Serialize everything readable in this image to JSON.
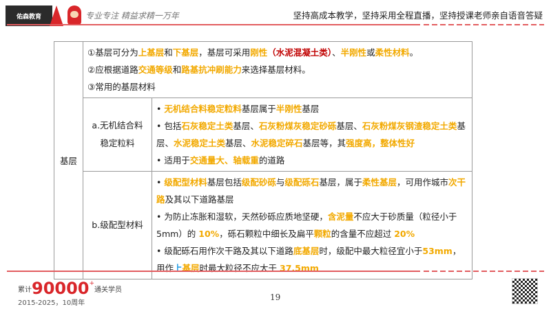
{
  "header": {
    "logo_text": "佑森教育",
    "calligraphy": "专业专注 精益求精一万年",
    "slogan": "坚持高成本教学，坚持采用全程直播，坚持授课老师亲自语音答疑"
  },
  "colors": {
    "orange": "#f2a900",
    "red": "#c00000",
    "blue": "#1e9be6",
    "brand": "#d9262a"
  },
  "table": {
    "row_header": "基层",
    "intro": [
      [
        {
          "t": "①基层可分为"
        },
        {
          "t": "上基层",
          "c": "o"
        },
        {
          "t": "和"
        },
        {
          "t": "下基层",
          "c": "o"
        },
        {
          "t": "，基层可采用"
        },
        {
          "t": "刚性",
          "c": "o"
        },
        {
          "t": "（水泥混凝土类）",
          "c": "r"
        },
        {
          "t": "、"
        },
        {
          "t": "半刚性",
          "c": "o"
        },
        {
          "t": "或"
        },
        {
          "t": "柔性材料",
          "c": "o"
        },
        {
          "t": "。"
        }
      ],
      [
        {
          "t": "②应根据道路"
        },
        {
          "t": "交通等级",
          "c": "o"
        },
        {
          "t": "和"
        },
        {
          "t": "路基抗冲刷能力",
          "c": "o"
        },
        {
          "t": "来选择基层材料。"
        }
      ],
      [
        {
          "t": "③常用的基层材料"
        }
      ]
    ],
    "rows": [
      {
        "label_1": "a.无机结合料",
        "label_2": "稳定粒料",
        "lines": [
          [
            {
              "t": "• "
            },
            {
              "t": "无机结合料稳定粒料",
              "c": "o"
            },
            {
              "t": "基层属于"
            },
            {
              "t": "半刚性",
              "c": "o"
            },
            {
              "t": "基层"
            }
          ],
          [
            {
              "t": "• 包括"
            },
            {
              "t": "石灰稳定土类",
              "c": "o"
            },
            {
              "t": "基层、"
            },
            {
              "t": "石灰粉煤灰稳定砂砾",
              "c": "o"
            },
            {
              "t": "基层、"
            },
            {
              "t": "石灰粉煤灰钢渣稳定土类",
              "c": "o"
            },
            {
              "t": "基层、"
            },
            {
              "t": "水泥稳定土类",
              "c": "o"
            },
            {
              "t": "基层、"
            },
            {
              "t": "水泥稳定碎石",
              "c": "o"
            },
            {
              "t": "基层等，其"
            },
            {
              "t": "强度高，整体性好",
              "c": "o"
            }
          ],
          [
            {
              "t": "• 适用于"
            },
            {
              "t": "交通量大、轴载重",
              "c": "o"
            },
            {
              "t": "的道路"
            }
          ]
        ]
      },
      {
        "label_1": "b.级配型材料",
        "label_2": "",
        "lines": [
          [
            {
              "t": "• "
            },
            {
              "t": "级配型材料",
              "c": "o"
            },
            {
              "t": "基层包括"
            },
            {
              "t": "级配砂砾",
              "c": "o"
            },
            {
              "t": "与"
            },
            {
              "t": "级配砾石",
              "c": "o"
            },
            {
              "t": "基层，属于"
            },
            {
              "t": "柔性基层",
              "c": "o"
            },
            {
              "t": "，可用作城市"
            },
            {
              "t": "次干路",
              "c": "o"
            },
            {
              "t": "及其以下道路基层"
            }
          ],
          [
            {
              "t": "• 为防止冻胀和湿软，天然砂砾应质地坚硬，"
            },
            {
              "t": "含泥量",
              "c": "o"
            },
            {
              "t": "不应大于砂质量（粒径小于 5mm）的 "
            },
            {
              "t": "10%",
              "c": "o"
            },
            {
              "t": "，砾石颗粒中细长及扁平"
            },
            {
              "t": "颗粒",
              "c": "o"
            },
            {
              "t": "的含量不应超过 "
            },
            {
              "t": "20%",
              "c": "o"
            }
          ],
          [
            {
              "t": "• 级配砾石用作次干路及其以下道路"
            },
            {
              "t": "底基层",
              "c": "o"
            },
            {
              "t": "时，级配中最大粒径宜小于"
            },
            {
              "t": "53mm",
              "c": "o"
            },
            {
              "t": "，用作"
            },
            {
              "t": "上",
              "c": "b"
            },
            {
              "t": "基层",
              "c": "o"
            },
            {
              "t": "时最大粒径不应大于 "
            },
            {
              "t": "37.5mm",
              "c": "o"
            }
          ]
        ]
      }
    ]
  },
  "footer": {
    "prefix": "累计",
    "count": "90000",
    "plus": "+",
    "suffix": "通关学员",
    "years": "2015-2025，10周年",
    "page": "19"
  }
}
